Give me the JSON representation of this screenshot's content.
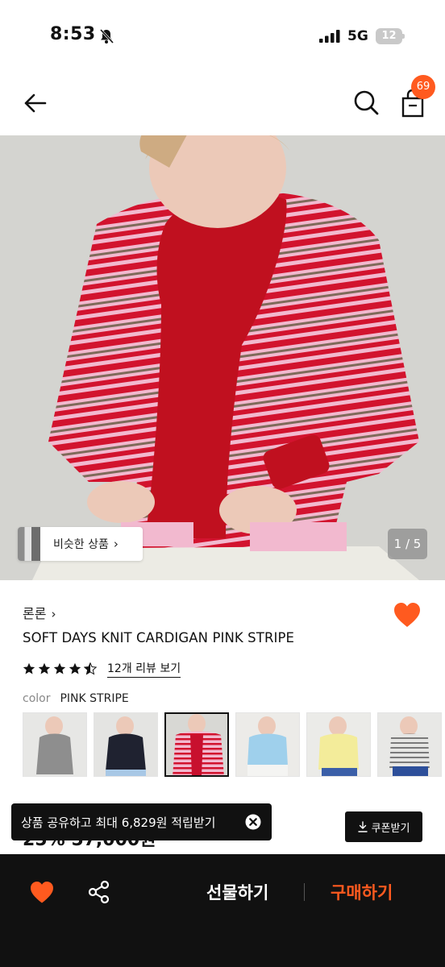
{
  "status_bar": {
    "time": "8:53",
    "network": "5G",
    "battery": "12"
  },
  "header": {
    "cart_count": "69"
  },
  "gallery": {
    "similar_label": "비슷한 상품",
    "page_indicator": "1 / 5",
    "current_page": 1,
    "total_pages": 5
  },
  "product": {
    "brand": "론론",
    "name": "SOFT DAYS KNIT CARDIGAN PINK STRIPE",
    "rating": 4.5,
    "review_link": "12개 리뷰 보기",
    "color_label": "color",
    "color_value": "PINK STRIPE",
    "price_partial": "25% 57,000원"
  },
  "swatches": [
    {
      "name": "gray",
      "color": "#8e8e8e",
      "selected": false
    },
    {
      "name": "navy",
      "color": "#1f2230",
      "selected": false
    },
    {
      "name": "pink stripe",
      "color": "#c8102e",
      "selected": true
    },
    {
      "name": "sky blue",
      "color": "#9fd0ec",
      "selected": false
    },
    {
      "name": "yellow",
      "color": "#f3ec9a",
      "selected": false
    },
    {
      "name": "gray stripe",
      "color": "#b9b9b9",
      "selected": false
    }
  ],
  "toast": {
    "text": "상품 공유하고 최대 6,829원 적립받기"
  },
  "coupon": {
    "label": "쿠폰받기"
  },
  "bottom_bar": {
    "gift_label": "선물하기",
    "buy_label": "구매하기"
  },
  "colors": {
    "accent": "#ff5a1f",
    "dark": "#111111"
  }
}
